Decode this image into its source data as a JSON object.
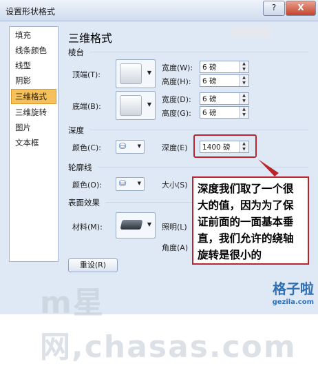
{
  "window": {
    "title": "设置形状格式",
    "help": "?",
    "close": "X"
  },
  "sidebar": {
    "items": [
      {
        "label": "填充"
      },
      {
        "label": "线条颜色"
      },
      {
        "label": "线型"
      },
      {
        "label": "阴影"
      },
      {
        "label": "三维格式",
        "active": true
      },
      {
        "label": "三维旋转"
      },
      {
        "label": "图片"
      },
      {
        "label": "文本框"
      }
    ]
  },
  "panel": {
    "title": "三维格式",
    "bevel": {
      "title": "棱台",
      "top_label": "顶端(T):",
      "bottom_label": "底端(B):",
      "width_label": "宽度(W):",
      "height_label": "高度(H):",
      "width2_label": "宽度(D):",
      "height2_label": "高度(G):",
      "top_width": "6 磅",
      "top_height": "6 磅",
      "bottom_width": "6 磅",
      "bottom_height": "6 磅"
    },
    "depth": {
      "title": "深度",
      "color_label": "颜色(C):",
      "depth_label": "深度(E)",
      "depth_value": "1400 磅"
    },
    "contour": {
      "title": "轮廓线",
      "color_label": "颜色(O):",
      "size_label": "大小(S)"
    },
    "surface": {
      "title": "表面效果",
      "material_label": "材料(M):",
      "lighting_label": "照明(L)",
      "angle_label": "角度(A)"
    },
    "reset": "重设(R)"
  },
  "callout": {
    "text": "深度我们取了一个很大的值，因为为了保证前面的一面基本垂直，我们允许的绕轴旋转是很小的"
  },
  "overlay": {
    "watermark": "m星网,chasas.com",
    "brand": "格子啦",
    "brand_sub": "gezila.com"
  },
  "colors": {
    "accent": "#f6c15a",
    "annotation": "#b6262c",
    "brand": "#2f6fb3"
  }
}
